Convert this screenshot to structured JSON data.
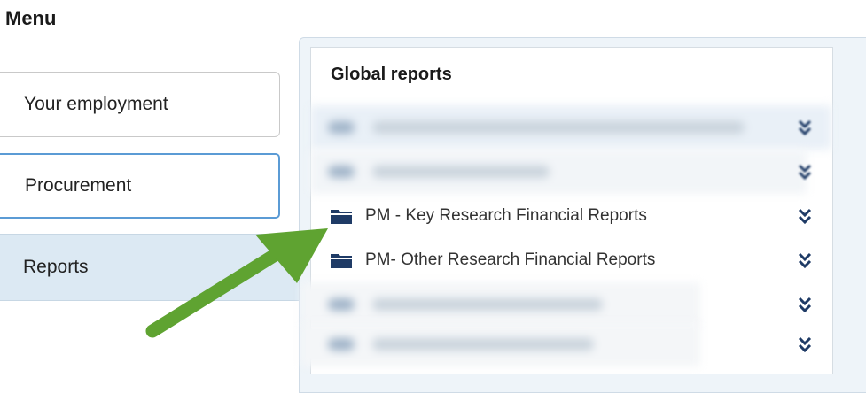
{
  "menu": {
    "title": "Menu"
  },
  "nav": {
    "items": [
      {
        "label": "Your employment"
      },
      {
        "label": "Procurement"
      },
      {
        "label": "Reports"
      }
    ]
  },
  "panel": {
    "title": "Global reports",
    "rows": [
      {
        "label": ""
      },
      {
        "label": ""
      },
      {
        "label": "PM - Key Research Financial Reports",
        "icon": "folder-icon"
      },
      {
        "label": "PM- Other Research Financial Reports",
        "icon": "folder-icon"
      },
      {
        "label": ""
      },
      {
        "label": ""
      }
    ]
  },
  "colors": {
    "accent_border": "#5b9bd5",
    "selected_bg": "#dce9f3",
    "folder": "#1f3b66",
    "arrow": "#5fa331"
  }
}
